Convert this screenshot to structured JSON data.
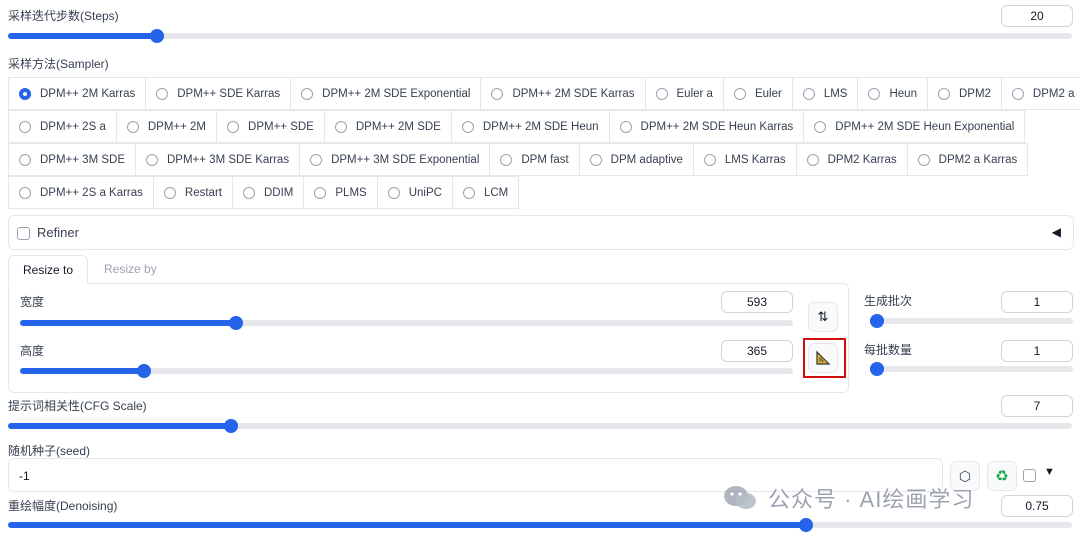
{
  "steps": {
    "label": "采样迭代步数(Steps)",
    "value": "20",
    "level": 0.14
  },
  "sampler": {
    "label": "采样方法(Sampler)",
    "selected": "DPM++ 2M Karras",
    "rows": [
      [
        "DPM++ 2M Karras",
        "DPM++ SDE Karras",
        "DPM++ 2M SDE Exponential",
        "DPM++ 2M SDE Karras",
        "Euler a",
        "Euler",
        "LMS",
        "Heun",
        "DPM2",
        "DPM2 a"
      ],
      [
        "DPM++ 2S a",
        "DPM++ 2M",
        "DPM++ SDE",
        "DPM++ 2M SDE",
        "DPM++ 2M SDE Heun",
        "DPM++ 2M SDE Heun Karras",
        "DPM++ 2M SDE Heun Exponential"
      ],
      [
        "DPM++ 3M SDE",
        "DPM++ 3M SDE Karras",
        "DPM++ 3M SDE Exponential",
        "DPM fast",
        "DPM adaptive",
        "LMS Karras",
        "DPM2 Karras",
        "DPM2 a Karras"
      ],
      [
        "DPM++ 2S a Karras",
        "Restart",
        "DDIM",
        "PLMS",
        "UniPC",
        "LCM"
      ]
    ]
  },
  "refiner": {
    "label": "Refiner",
    "toggle_icon": "triangle-left-icon"
  },
  "tabs": {
    "resize_to": "Resize to",
    "resize_by": "Resize by"
  },
  "width": {
    "label": "宽度",
    "value": "593",
    "level": 0.28
  },
  "height": {
    "label": "高度",
    "value": "365",
    "level": 0.16
  },
  "batch_count": {
    "label": "生成批次",
    "value": "1",
    "level": 0.0
  },
  "batch_size": {
    "label": "每批数量",
    "value": "1",
    "level": 0.0
  },
  "cfg": {
    "label": "提示词相关性(CFG Scale)",
    "value": "7",
    "level": 0.21
  },
  "seed": {
    "label": "随机种子(seed)",
    "value": "-1"
  },
  "denoising": {
    "label": "重绘幅度(Denoising)",
    "value": "0.75",
    "level": 0.75
  },
  "watermark": {
    "text": "公众号 · AI绘画学习"
  },
  "colors": {
    "accent": "#2563eb",
    "highlight_border": "#d10f0f"
  }
}
